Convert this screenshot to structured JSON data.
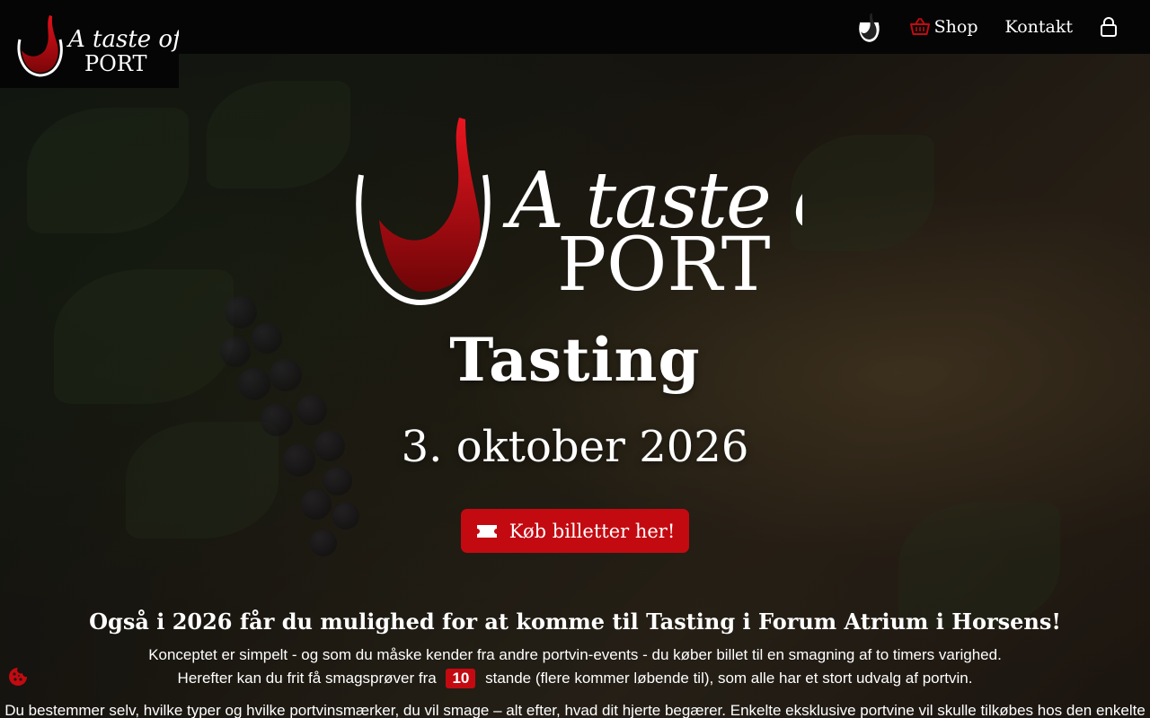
{
  "brand": {
    "line1": "A taste of",
    "line2": "PORT",
    "accent_color": "#c30a11"
  },
  "nav": {
    "home_icon": "wine-glass-icon",
    "shop_label": "Shop",
    "shop_icon": "basket-icon",
    "contact_label": "Kontakt",
    "login_icon": "lock-icon"
  },
  "hero": {
    "title": "Tasting",
    "date": "3. oktober 2026",
    "cta_label": "Køb billetter her!",
    "cta_icon": "ticket-icon"
  },
  "intro": {
    "heading": "Også i 2026 får du mulighed for at komme til Tasting i Forum Atrium i Horsens!",
    "line1": "Konceptet er simpelt - og som du måske kender fra andre portvin-events - du køber billet til en smagning af to timers varighed.",
    "line2_before": "Herefter kan du frit få smagsprøver fra",
    "stand_count": "10",
    "line2_after": "stande (flere kommer løbende til), som alle har et stort udvalg af portvin.",
    "line3": "Du bestemmer selv, hvilke typer og hvilke portvinsmærker, du vil smage – alt efter, hvad dit hjerte begærer. Enkelte eksklusive portvine vil skulle tilkøbes hos den enkelte"
  },
  "cookie": {
    "icon": "cookie-icon"
  }
}
